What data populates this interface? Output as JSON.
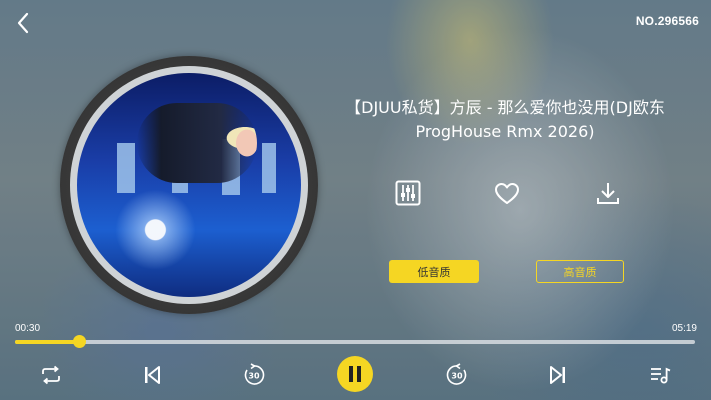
{
  "header": {
    "back_icon": "chevron-left-icon",
    "serial": "NO.296566"
  },
  "song": {
    "title": "【DJUU私货】方辰 - 那么爱你也没用(DJ欧东ProgHouse Rmx 2026)"
  },
  "actions": {
    "equalizer_icon": "equalizer-icon",
    "like_icon": "heart-icon",
    "download_icon": "download-icon"
  },
  "quality": {
    "low_label": "低音质",
    "high_label": "高音质",
    "selected": "low"
  },
  "progress": {
    "current": "00:30",
    "total": "05:19",
    "fraction": 0.094
  },
  "controls": {
    "repeat_icon": "repeat-icon",
    "prev_icon": "skip-previous-icon",
    "rewind_label": "30",
    "play_pause_icon": "pause-icon",
    "forward_label": "30",
    "next_icon": "skip-next-icon",
    "playlist_icon": "playlist-icon"
  },
  "colors": {
    "accent": "#f5d623",
    "text": "#ffffff"
  }
}
